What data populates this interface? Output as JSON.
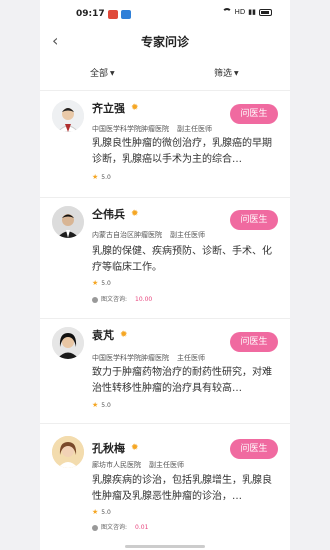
{
  "status": {
    "time": "09:17",
    "network": "HD"
  },
  "header": {
    "title": "专家问诊"
  },
  "filters": {
    "left": "全部",
    "right": "筛选"
  },
  "ask_label": "问医生",
  "consult_label": "图文咨询:",
  "doctors": [
    {
      "name": "齐立强",
      "hospital": "中国医学科学院肿瘤医院",
      "title": "副主任医师",
      "desc": "乳腺良性肿瘤的微创治疗，乳腺癌的早期诊断，乳腺癌以手术为主的综合…",
      "rating": "5.0",
      "price": ""
    },
    {
      "name": "仝伟兵",
      "hospital": "内蒙古自治区肿瘤医院",
      "title": "副主任医师",
      "desc": "乳腺的保健、疾病预防、诊断、手术、化疗等临床工作。",
      "rating": "5.0",
      "price": "10.00"
    },
    {
      "name": "袁芃",
      "hospital": "中国医学科学院肿瘤医院",
      "title": "主任医师",
      "desc": "致力于肿瘤药物治疗的耐药性研究，对难治性转移性肿瘤的治疗具有较高…",
      "rating": "5.0",
      "price": ""
    },
    {
      "name": "孔秋梅",
      "hospital": "廊坊市人民医院",
      "title": "副主任医师",
      "desc": "乳腺疾病的诊治，包括乳腺增生，乳腺良性肿瘤及乳腺恶性肿瘤的诊治，…",
      "rating": "5.0",
      "price": "0.01"
    }
  ]
}
